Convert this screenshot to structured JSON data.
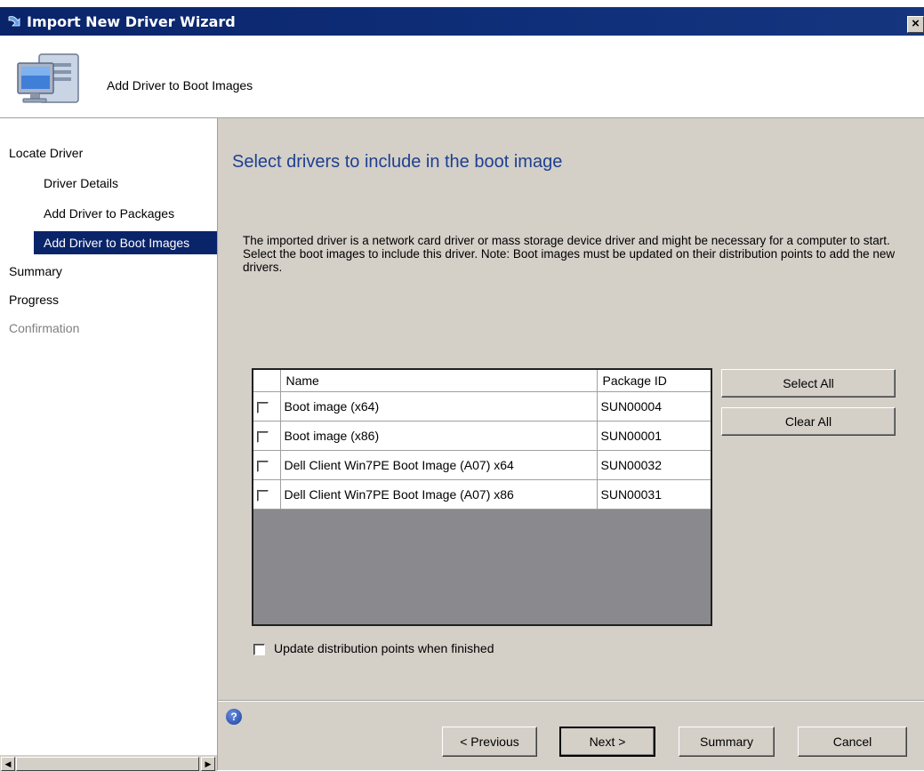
{
  "window": {
    "title": "Import New Driver Wizard",
    "close_label": "×"
  },
  "header": {
    "title": "Add Driver to Boot Images",
    "icon": "computer-monitor-icon"
  },
  "nav": {
    "items": [
      {
        "label": "Locate Driver",
        "level": "top",
        "state": "normal"
      },
      {
        "label": "Driver Details",
        "level": "sub",
        "state": "normal"
      },
      {
        "label": "Add Driver to Packages",
        "level": "sub",
        "state": "normal"
      },
      {
        "label": "Add Driver to Boot Images",
        "level": "sub",
        "state": "selected"
      },
      {
        "label": "Summary",
        "level": "top",
        "state": "normal"
      },
      {
        "label": "Progress",
        "level": "top",
        "state": "normal"
      },
      {
        "label": "Confirmation",
        "level": "top",
        "state": "disabled"
      }
    ]
  },
  "main": {
    "heading": "Select drivers to include in the boot image",
    "description": "The imported driver is a network card driver or mass storage device driver and might be necessary for a computer to start. Select the boot images to include this driver.  Note: Boot images must be updated on their distribution points to add the new drivers.",
    "grid": {
      "columns": [
        "Name",
        "Package ID"
      ],
      "rows": [
        {
          "name": "Boot image (x64)",
          "package_id": "SUN00004",
          "checked": false
        },
        {
          "name": "Boot image (x86)",
          "package_id": "SUN00001",
          "checked": false
        },
        {
          "name": "Dell Client Win7PE Boot Image (A07) x64",
          "package_id": "SUN00032",
          "checked": false
        },
        {
          "name": "Dell Client Win7PE Boot Image (A07) x86",
          "package_id": "SUN00031",
          "checked": false
        }
      ]
    },
    "select_all_label": "Select All",
    "clear_all_label": "Clear All",
    "update_dp_label": "Update distribution points when finished",
    "update_dp_checked": false
  },
  "footer": {
    "help_icon": "help-icon",
    "previous_label": "< Previous",
    "next_label": "Next >",
    "summary_label": "Summary",
    "cancel_label": "Cancel"
  },
  "colors": {
    "title_bar": "#0a246a",
    "selection": "#0a246a",
    "heading": "#1f3f8f",
    "dialog_face": "#d4d0c8",
    "grid_empty": "#8a8a8e"
  }
}
